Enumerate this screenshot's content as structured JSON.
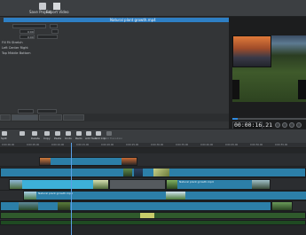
{
  "toolbar": {
    "save_project_label": "Save Project",
    "export_video_label": "Export Video"
  },
  "properties": {
    "clip_title": "Natural plant growth.mp4",
    "row1_label": "",
    "row1_value": "0:00",
    "row2_value": "0:00",
    "row3_value": "0:00",
    "row4_value": "0:00",
    "row5_value": "0:00",
    "flip_options": "Fill  Fit  Stretch",
    "halign_options": "Left  Center  Right",
    "valign_options": "Top  Middle  Bottom",
    "tabs": [
      "",
      "",
      "",
      ""
    ]
  },
  "preview": {
    "timecode": "00:00:16.21"
  },
  "timeline_toolbar": {
    "labels": [
      "Split",
      "",
      "Delete",
      "Copy",
      "Paste",
      "Undo",
      "Redo",
      "Add Text",
      "Add Clip",
      "Add Transition"
    ]
  },
  "ruler": {
    "ticks": [
      "0:00:00.00",
      "0:00:05.00",
      "0:00:10.00",
      "0:00:15.00",
      "0:00:20.00",
      "0:00:25.00",
      "0:00:30.00",
      "0:00:35.00",
      "0:00:40.00",
      "0:00:45.00",
      "0:00:50.00",
      "0:00:55.00"
    ]
  },
  "tracks": {
    "clip_a": "",
    "clip_b": "",
    "clip_c": "Natural plant growth.mp4",
    "clip_d": "Natural plant growth.mp4"
  },
  "colors": {
    "accent": "#2e7fc4",
    "clip_blue": "#2c7fa8",
    "clip_green": "#2f5a2c",
    "playhead": "#5aa0e6"
  }
}
